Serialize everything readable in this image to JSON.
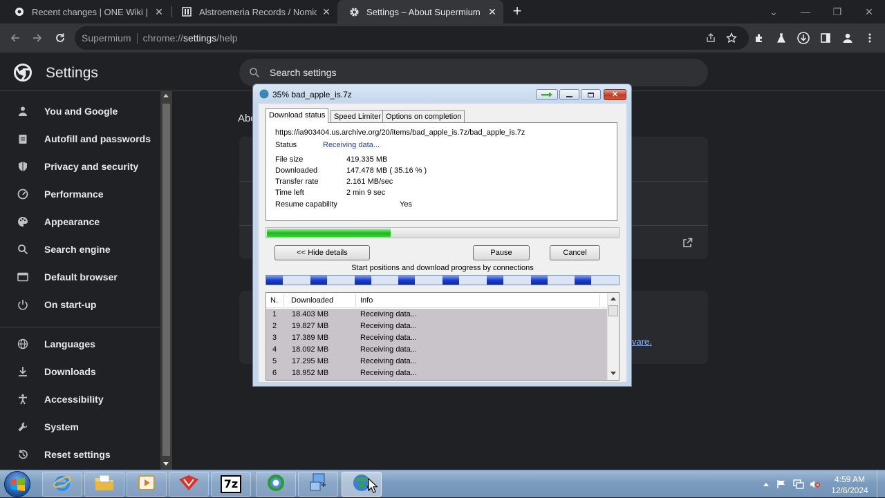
{
  "browser": {
    "tabs": [
      {
        "title": "Recent changes | ONE Wiki | Fan",
        "icon": "fandom-icon",
        "active": false
      },
      {
        "title": "Alstroemeria Records / Nomico",
        "icon": "page-icon",
        "active": false
      },
      {
        "title": "Settings – About Supermium",
        "icon": "gear-icon",
        "active": true
      }
    ],
    "new_tab": "+",
    "address": {
      "host_label": "Supermium",
      "scheme": "chrome://",
      "path_bold": "settings",
      "path_rest": "/help"
    }
  },
  "settings": {
    "title": "Settings",
    "search_placeholder": "Search settings",
    "nav": [
      {
        "label": "You and Google",
        "icon": "person-icon"
      },
      {
        "label": "Autofill and passwords",
        "icon": "clipboard-icon"
      },
      {
        "label": "Privacy and security",
        "icon": "shield-icon"
      },
      {
        "label": "Performance",
        "icon": "gauge-icon"
      },
      {
        "label": "Appearance",
        "icon": "palette-icon"
      },
      {
        "label": "Search engine",
        "icon": "search-icon"
      },
      {
        "label": "Default browser",
        "icon": "browser-icon"
      },
      {
        "label": "On start-up",
        "icon": "power-icon"
      },
      {
        "label": "Languages",
        "icon": "globe-icon"
      },
      {
        "label": "Downloads",
        "icon": "download-icon"
      },
      {
        "label": "Accessibility",
        "icon": "accessibility-icon"
      },
      {
        "label": "System",
        "icon": "wrench-icon"
      },
      {
        "label": "Reset settings",
        "icon": "reset-icon"
      }
    ],
    "about_heading_partial": "Abo",
    "link_partial": "vare."
  },
  "dialog": {
    "title": "35% bad_apple_is.7z",
    "tabs": [
      "Download status",
      "Speed Limiter",
      "Options on completion"
    ],
    "url": "https://ia903404.us.archive.org/20/items/bad_apple_is.7z/bad_apple_is.7z",
    "status_label": "Status",
    "status_value": "Receiving data...",
    "fields": [
      {
        "label": "File size",
        "value": "419.335  MB"
      },
      {
        "label": "Downloaded",
        "value": "147.478  MB  ( 35.16 % )"
      },
      {
        "label": "Transfer rate",
        "value": "2.161  MB/sec"
      },
      {
        "label": "Time left",
        "value": "2 min 9 sec"
      }
    ],
    "resume_label": "Resume capability",
    "resume_value": "Yes",
    "progress_fraction": 0.3516,
    "buttons": {
      "hide_details": "<< Hide details",
      "pause": "Pause",
      "cancel": "Cancel"
    },
    "connections_caption": "Start positions and download progress by connections",
    "connection_starts": [
      0.0,
      0.125,
      0.25,
      0.375,
      0.5,
      0.625,
      0.75,
      0.875
    ],
    "list_headers": [
      "N.",
      "Downloaded",
      "Info"
    ],
    "rows": [
      {
        "n": "1",
        "downloaded": "18.403  MB",
        "info": "Receiving data..."
      },
      {
        "n": "2",
        "downloaded": "19.827  MB",
        "info": "Receiving data..."
      },
      {
        "n": "3",
        "downloaded": "17.389  MB",
        "info": "Receiving data..."
      },
      {
        "n": "4",
        "downloaded": "18.092  MB",
        "info": "Receiving data..."
      },
      {
        "n": "5",
        "downloaded": "17.295  MB",
        "info": "Receiving data..."
      },
      {
        "n": "6",
        "downloaded": "18.952  MB",
        "info": "Receiving data..."
      }
    ]
  },
  "taskbar": {
    "apps": [
      "internet-explorer-icon",
      "file-explorer-icon",
      "media-player-icon",
      "app-icon",
      "7zip-icon",
      "supermium-icon",
      "network-icon",
      "idm-icon"
    ],
    "seven_zip_label": "7z",
    "clock_time": "4:59 AM",
    "clock_date": "12/6/2024"
  },
  "colors": {
    "accent": "#8ab4f8",
    "progress": "#16b816",
    "connection": "#1b3fcf"
  }
}
